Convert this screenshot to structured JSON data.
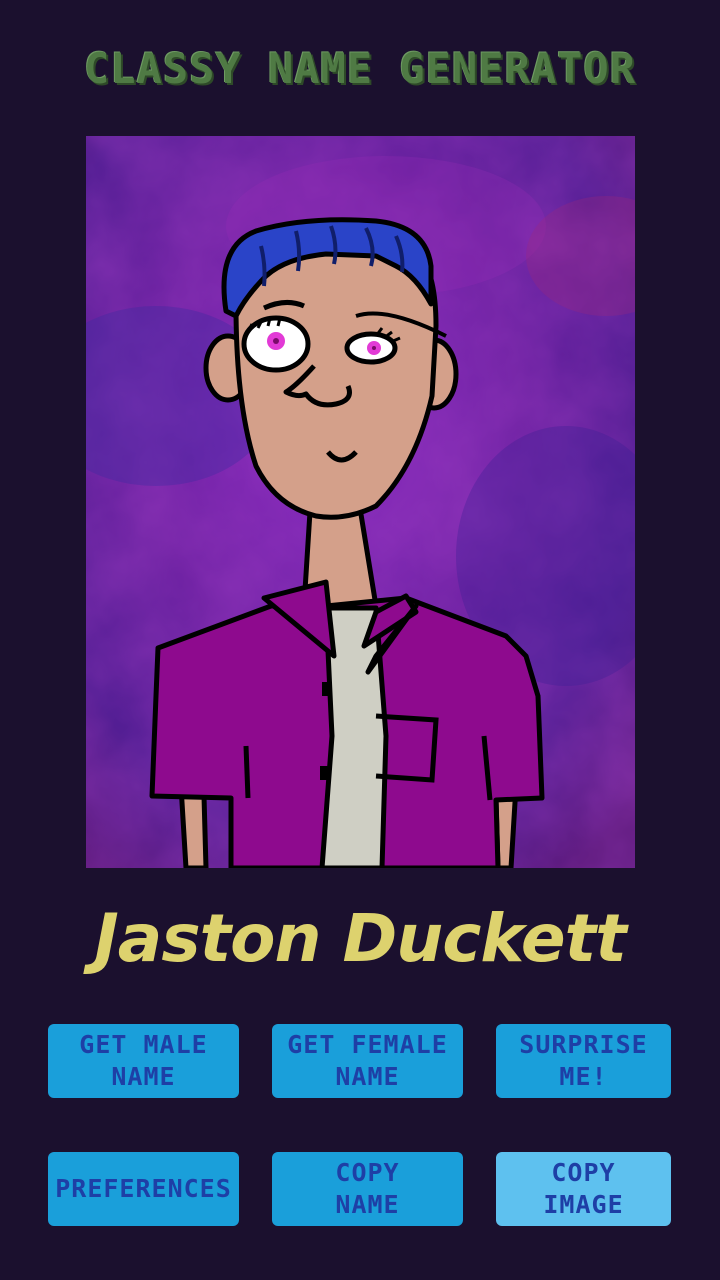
{
  "app": {
    "title": "Classy Name Generator"
  },
  "portrait": {
    "description_icon": "cartoon-portrait-icon",
    "colors": {
      "background": "#6a1fa0",
      "hair": "#2a44c8",
      "skin": "#d4a08a",
      "shirt": "#8e0a8e",
      "undershirt": "#cfcfc4",
      "eyes": "#e23ad6"
    }
  },
  "result": {
    "name": "Jaston Duckett",
    "color": "#ddd26e"
  },
  "buttons": {
    "get_male": "Get Male\nName",
    "get_female": "Get Female\nName",
    "surprise": "Surprise\nMe!",
    "preferences": "Preferences",
    "copy_name": "Copy\nName",
    "copy_image": "Copy\nImage",
    "accent": "#1a9fda",
    "accent_light": "#5ec1ef",
    "text_color": "#1e3fa6"
  }
}
